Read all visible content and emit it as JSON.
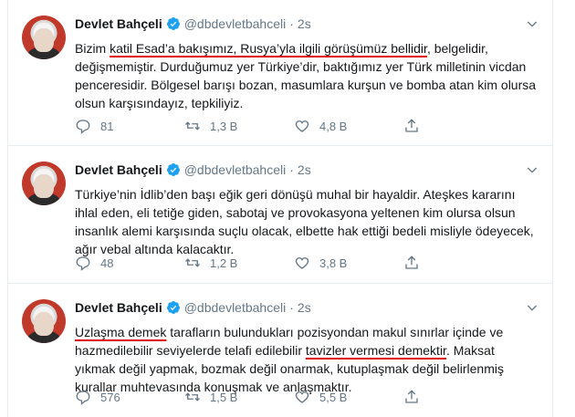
{
  "tweets": [
    {
      "name": "Devlet Bahçeli",
      "handle": "@dbdevletbahceli",
      "separator": "·",
      "time": "2s",
      "text_parts": [
        "Bizim ",
        "katil Esad’a bakışımız, Rusya’yla ilgili görüşümüz bellidir",
        ", belgelidir, değişmemiştir. Durduğumuz yer Türkiye’dir, baktığımız yer Türk milletinin vicdan penceresidir. Bölgesel barışı bozan, masumlara kurşun ve bomba atan kim olursa olsun karşısındayız, tepkiliyiz."
      ],
      "replies": "81",
      "retweets": "1,3 B",
      "likes": "4,8 B"
    },
    {
      "name": "Devlet Bahçeli",
      "handle": "@dbdevletbahceli",
      "separator": "·",
      "time": "2s",
      "text_parts": [
        "Türkiye’nin İdlib’den başı eğik geri dönüşü muhal bir hayaldir. Ateşkes kararını ihlal eden, eli tetiğe giden, sabotaj ve provokasyona yeltenen kim olursa olsun insanlık alemi karşısında suçlu olacak, elbette hak ettiği bedeli misliyle ödeyecek, ağır vebal altında kalacaktır."
      ],
      "replies": "48",
      "retweets": "1,2 B",
      "likes": "3,8 B"
    },
    {
      "name": "Devlet Bahçeli",
      "handle": "@dbdevletbahceli",
      "separator": "·",
      "time": "2s",
      "text_parts": [
        "Uzlaşma demek",
        " tarafların bulundukları pozisyondan makul sınırlar içinde ve hazmedilebilir seviyelerde telafi edilebilir ",
        "tavizler vermesi demektir",
        ". Maksat yıkmak değil yapmak, bozmak değil onarmak, kutuplaşmak değil belirlenmiş kurallar muhtevasında konuşmak ve anlaşmaktır."
      ],
      "replies": "576",
      "retweets": "1,5 B",
      "likes": "5,5 B"
    }
  ],
  "colors": {
    "text": "#14171a",
    "muted": "#657786",
    "verified": "#1da1f2",
    "underline": "#e0000a",
    "border": "#e6ecf0"
  },
  "icons": {
    "verified": "verified-badge-icon",
    "chevron": "chevron-down-icon",
    "reply": "reply-icon",
    "retweet": "retweet-icon",
    "like": "heart-icon",
    "share": "share-icon"
  }
}
